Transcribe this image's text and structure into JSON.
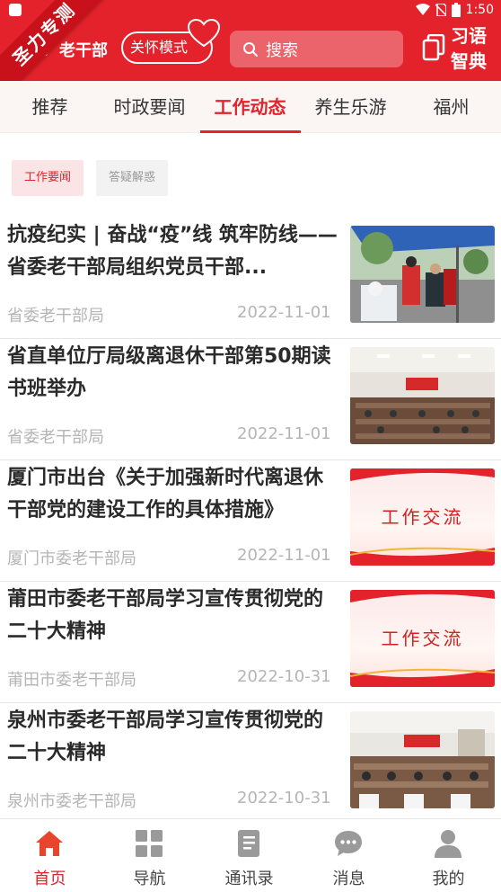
{
  "status": {
    "time": "1:50"
  },
  "header": {
    "ribbon": "圣力专测",
    "logo_text": "老干部",
    "care_mode": "关怀模式",
    "search_placeholder": "搜索",
    "dict_label_1": "习语",
    "dict_label_2": "智典",
    "accent": "#e3222b"
  },
  "tabs": [
    {
      "label": "推荐"
    },
    {
      "label": "时政要闻"
    },
    {
      "label": "工作动态"
    },
    {
      "label": "养生乐游"
    },
    {
      "label": "福州"
    }
  ],
  "active_tab": "工作动态",
  "subtags": [
    {
      "label": "工作要闻"
    },
    {
      "label": "答疑解惑"
    }
  ],
  "articles": [
    {
      "title": "抗疫纪实 | 奋战“疫”线 筑牢防线——省委老干部局组织党员干部...",
      "source": "省委老干部局",
      "date": "2022-11-01",
      "thumb": "photo-outdoor-testing"
    },
    {
      "title": "省直单位厅局级离退休干部第50期读书班举办",
      "source": "省委老干部局",
      "date": "2022-11-01",
      "thumb": "photo-meeting-hall"
    },
    {
      "title": "厦门市出台《关于加强新时代离退休干部党的建设工作的具体措施》",
      "source": "厦门市委老干部局",
      "date": "2022-11-01",
      "thumb": "banner-work-exchange",
      "thumb_text": "工作交流"
    },
    {
      "title": "莆田市委老干部局学习宣传贯彻党的二十大精神",
      "source": "莆田市委老干部局",
      "date": "2022-10-31",
      "thumb": "banner-work-exchange",
      "thumb_text": "工作交流"
    },
    {
      "title": "泉州市委老干部局学习宣传贯彻党的二十大精神",
      "source": "泉州市委老干部局",
      "date": "2022-10-31",
      "thumb": "photo-meeting-room"
    }
  ],
  "bottom_nav": [
    {
      "label": "首页",
      "icon": "home-icon"
    },
    {
      "label": "导航",
      "icon": "grid-icon"
    },
    {
      "label": "通讯录",
      "icon": "contacts-book-icon"
    },
    {
      "label": "消息",
      "icon": "chat-bubble-icon"
    },
    {
      "label": "我的",
      "icon": "person-icon"
    }
  ],
  "active_nav": "首页"
}
